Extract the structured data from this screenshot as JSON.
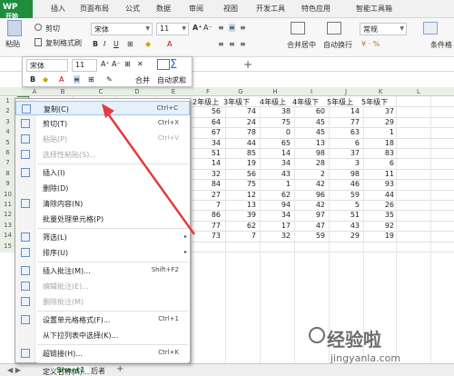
{
  "app": {
    "badge": "WP"
  },
  "menu_tabs": [
    "开始",
    "插入",
    "页面布局",
    "公式",
    "数据",
    "审阅",
    "视图",
    "开发工具",
    "特色应用",
    "智能工具箱"
  ],
  "ribbon": {
    "paste": "粘贴",
    "cut": "剪切",
    "copy": "复制",
    "format_painter": "格式刷",
    "font_name": "宋体",
    "font_size": "11",
    "merge_center": "合并居中",
    "wrap_text": "自动换行",
    "number_format": "常规",
    "conditional_format": "条件格"
  },
  "mini_toolbar": {
    "font_name": "宋体",
    "font_size": "11",
    "merge": "合并",
    "autosum": "自动求和"
  },
  "columns": [
    "A",
    "B",
    "C",
    "D",
    "E",
    "F",
    "G",
    "H",
    "I",
    "J",
    "K",
    "L"
  ],
  "rows": [
    "1",
    "2",
    "3",
    "4",
    "5",
    "6",
    "7",
    "8",
    "9",
    "10",
    "11",
    "12",
    "13",
    "14",
    "15"
  ],
  "row_prefix": "小",
  "table": {
    "headers": [
      "2年级上",
      "3年级下",
      "4年级上",
      "4年级下",
      "5年级上",
      "5年级下"
    ],
    "data": [
      [
        "56",
        "74",
        "38",
        "60",
        "14",
        "37"
      ],
      [
        "64",
        "24",
        "75",
        "45",
        "77",
        "29"
      ],
      [
        "67",
        "78",
        "0",
        "45",
        "63",
        "1"
      ],
      [
        "34",
        "44",
        "65",
        "13",
        "6",
        "18"
      ],
      [
        "51",
        "85",
        "14",
        "98",
        "37",
        "83"
      ],
      [
        "14",
        "19",
        "34",
        "28",
        "3",
        "6"
      ],
      [
        "32",
        "56",
        "43",
        "2",
        "98",
        "11"
      ],
      [
        "84",
        "75",
        "1",
        "42",
        "46",
        "93"
      ],
      [
        "27",
        "12",
        "62",
        "96",
        "59",
        "44"
      ],
      [
        "7",
        "13",
        "94",
        "42",
        "5",
        "26"
      ],
      [
        "86",
        "39",
        "34",
        "97",
        "51",
        "35"
      ],
      [
        "77",
        "62",
        "17",
        "47",
        "43",
        "92"
      ],
      [
        "73",
        "7",
        "32",
        "59",
        "29",
        "19"
      ]
    ]
  },
  "context_menu": {
    "items": [
      {
        "label": "复制(C)",
        "shortcut": "Ctrl+C",
        "icon": "copy-icon"
      },
      {
        "label": "剪切(T)",
        "shortcut": "Ctrl+X",
        "icon": "scissors-icon"
      },
      {
        "label": "粘贴(P)",
        "shortcut": "Ctrl+V",
        "icon": "paste-icon"
      },
      {
        "label": "选择性粘贴(S)...",
        "shortcut": "",
        "icon": "paste-special-icon"
      },
      {
        "label": "插入(I)",
        "shortcut": "",
        "icon": "insert-icon"
      },
      {
        "label": "删除(D)",
        "shortcut": "",
        "icon": ""
      },
      {
        "label": "清除内容(N)",
        "shortcut": "",
        "icon": "eraser-icon"
      },
      {
        "label": "批量处理单元格(P)",
        "shortcut": "",
        "icon": ""
      },
      {
        "label": "筛选(L)",
        "shortcut": "",
        "icon": "filter-icon"
      },
      {
        "label": "排序(U)",
        "shortcut": "",
        "icon": "sort-icon"
      },
      {
        "label": "插入批注(M)...",
        "shortcut": "Shift+F2",
        "icon": "comment-icon"
      },
      {
        "label": "编辑批注(E)...",
        "shortcut": "",
        "icon": "edit-comment-icon"
      },
      {
        "label": "删除批注(M)",
        "shortcut": "",
        "icon": "delete-comment-icon"
      },
      {
        "label": "设置单元格格式(F)...",
        "shortcut": "Ctrl+1",
        "icon": "format-cells-icon"
      },
      {
        "label": "从下拉列表中选择(K)...",
        "shortcut": "",
        "icon": ""
      },
      {
        "label": "超链接(H)...",
        "shortcut": "Ctrl+K",
        "icon": "hyperlink-icon"
      },
      {
        "label": "定义名称(A)...",
        "shortcut": "",
        "icon": ""
      }
    ]
  },
  "sheets": {
    "active": "Sheet1",
    "other": "后者"
  },
  "watermark": {
    "main": "经验啦",
    "sub": "jingyanla.com"
  },
  "colors": {
    "accent_green": "#1e8e3e",
    "arrow_red": "#e33d3d",
    "highlight": "#e5f0fb"
  }
}
